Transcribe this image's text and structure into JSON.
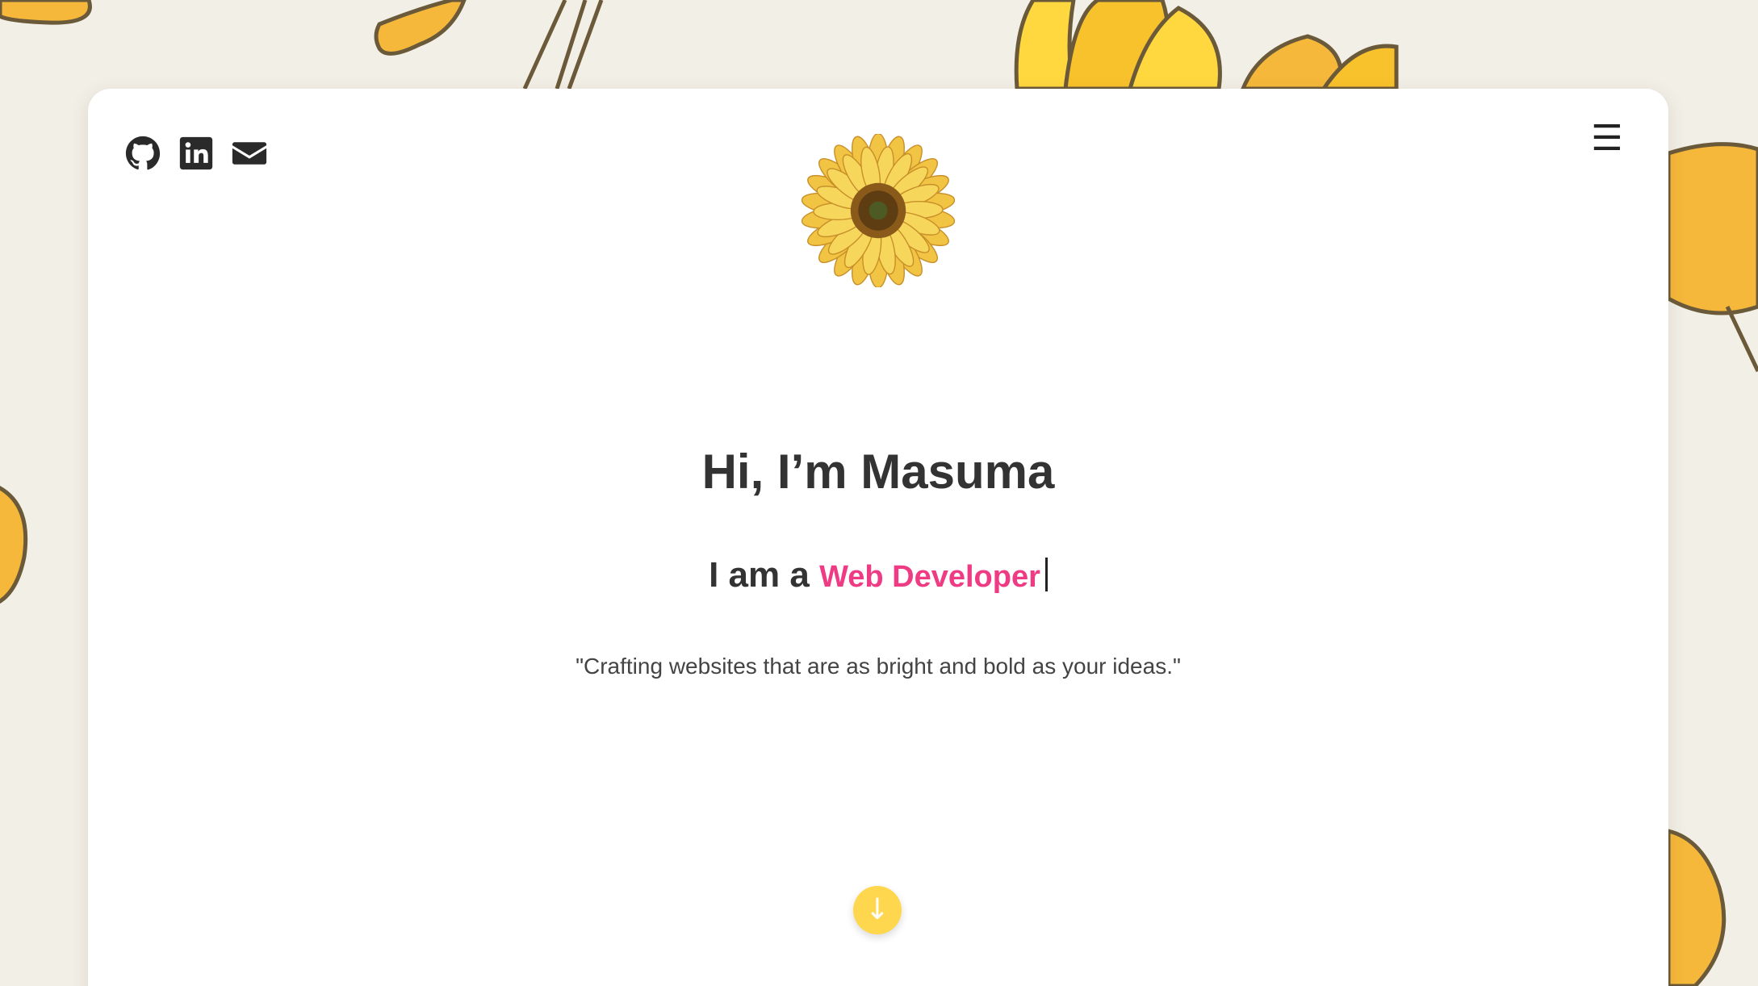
{
  "social": {
    "github_label": "GitHub",
    "linkedin_label": "LinkedIn",
    "email_label": "Email"
  },
  "menu": {
    "icon_char": "☰"
  },
  "hero": {
    "title": "Hi, I’m Masuma",
    "subtitle_prefix": "I am a ",
    "role": "Web Developer",
    "tagline": "\"Crafting websites that are as bright and bold as your ideas.\""
  },
  "scroll": {
    "arrow_char": "↓"
  },
  "colors": {
    "background": "#f2efe7",
    "card": "#ffffff",
    "accent_pink": "#ef3b84",
    "accent_yellow": "#ffd74e",
    "text_dark": "#333333"
  },
  "icons": {
    "github": "github-icon",
    "linkedin": "linkedin-icon",
    "email": "envelope-icon",
    "menu": "hamburger-menu-icon",
    "logo": "sunflower-logo",
    "scroll": "arrow-down-icon"
  }
}
